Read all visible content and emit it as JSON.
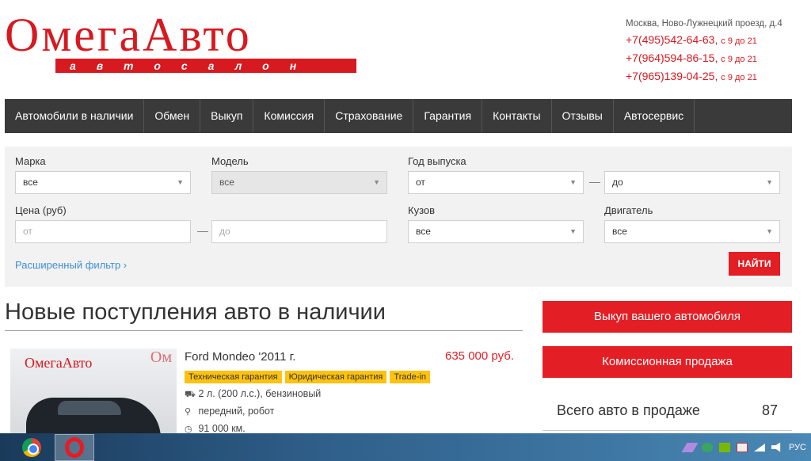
{
  "header": {
    "logo_main": "ОмегаАвто",
    "logo_sub": "автосалон",
    "address": "Москва, Ново-Лужнецкий проезд, д.4",
    "phones": [
      {
        "number": "+7(495)542-64-63,",
        "hours": "с 9 до 21"
      },
      {
        "number": "+7(964)594-86-15,",
        "hours": "с 9 до 21"
      },
      {
        "number": "+7(965)139-04-25,",
        "hours": "с 9 до 21"
      }
    ]
  },
  "nav": {
    "items": [
      "Автомобили в наличии",
      "Обмен",
      "Выкуп",
      "Комиссия",
      "Страхование",
      "Гарантия",
      "Контакты",
      "Отзывы",
      "Автосервис"
    ]
  },
  "filter": {
    "brand": {
      "label": "Марка",
      "value": "все"
    },
    "model": {
      "label": "Модель",
      "value": "все"
    },
    "year": {
      "label": "Год выпуска",
      "from": "от",
      "to": "до"
    },
    "price": {
      "label": "Цена (руб)",
      "from_placeholder": "от",
      "to_placeholder": "до"
    },
    "body": {
      "label": "Кузов",
      "value": "все"
    },
    "engine": {
      "label": "Двигатель",
      "value": "все"
    },
    "dash": "—",
    "advanced_link": "Расширенный фильтр ›",
    "find_button": "НАЙТИ"
  },
  "listing": {
    "title": "Новые поступления авто в наличии",
    "car": {
      "photo_logo": "ОмегаАвто",
      "photo_logo_right": "Ом",
      "name": "Ford Mondeo '2011 г.",
      "price": "635 000 руб.",
      "badges": [
        "Техническая гарантия",
        "Юридическая гарантия",
        "Trade-in"
      ],
      "engine": "2 л. (200 л.с.), бензиновый",
      "drive": "передний, робот",
      "mileage": "91 000 км."
    }
  },
  "sidebar": {
    "buyout_button": "Выкуп вашего автомобиля",
    "commission_button": "Комиссионная продажа",
    "total_label": "Всего авто в продаже",
    "total_count": "87"
  },
  "taskbar": {
    "apps": [
      "chrome-icon",
      "opera-icon"
    ],
    "lang": "РУС"
  },
  "colors": {
    "accent": "#e31e24",
    "nav_bg": "#3a3a3a",
    "badge": "#ffc20e",
    "link": "#3d8ed5"
  }
}
